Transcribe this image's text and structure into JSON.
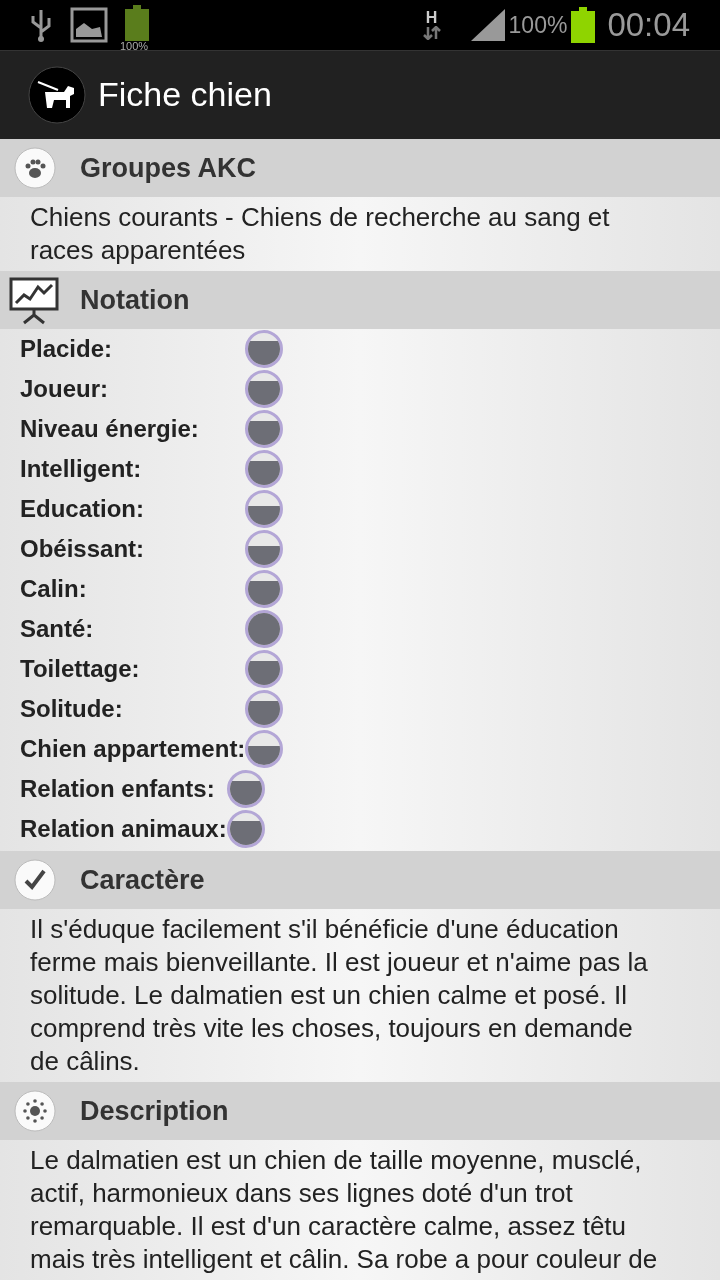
{
  "status_bar": {
    "battery_small_text": "100%",
    "network": "H",
    "battery_percent": "100%",
    "time": "00:04"
  },
  "action_bar": {
    "title": "Fiche chien"
  },
  "sections": [
    {
      "kind": "text",
      "title": "Groupes AKC",
      "text": "Chiens courants - Chiens de recherche au sang et races apparentées"
    },
    {
      "kind": "ratings",
      "title": "Notation",
      "tables": [
        [
          {
            "label": "Placide:",
            "kind": "high"
          },
          {
            "label": "Joueur:",
            "kind": "high"
          },
          {
            "label": "Niveau énergie:",
            "kind": "high"
          },
          {
            "label": "Intelligent:",
            "kind": "high"
          },
          {
            "label": "Education:",
            "kind": "medium"
          },
          {
            "label": "Obéissant:",
            "kind": "medium"
          },
          {
            "label": "Calin:",
            "kind": "high"
          },
          {
            "label": "Santé:",
            "kind": "full"
          },
          {
            "label": "Toilettage:",
            "kind": "high"
          },
          {
            "label": "Solitude:",
            "kind": "high"
          },
          {
            "label": "Chien appartement:",
            "kind": "medium"
          }
        ],
        [
          {
            "label": "Relation enfants:",
            "kind": "high"
          },
          {
            "label": "Relation animaux:",
            "kind": "high"
          }
        ]
      ]
    },
    {
      "kind": "text",
      "title": "Caractère",
      "text": "Il s'éduque facilement s'il bénéficie d'une éducation ferme mais bienveillante. Il est joueur et n'aime pas la solitude. Le dalmatien est un chien calme et posé. Il comprend très vite les choses, toujours en demande de câlins."
    },
    {
      "kind": "text",
      "title": "Description",
      "text": "Le dalmatien est un chien de taille moyenne, musclé, actif, harmonieux dans ses lignes doté d'un trot remarquable. Il est d'un caractère calme, assez têtu mais très intelligent et câlin. Sa robe a pour couleur de"
    }
  ]
}
